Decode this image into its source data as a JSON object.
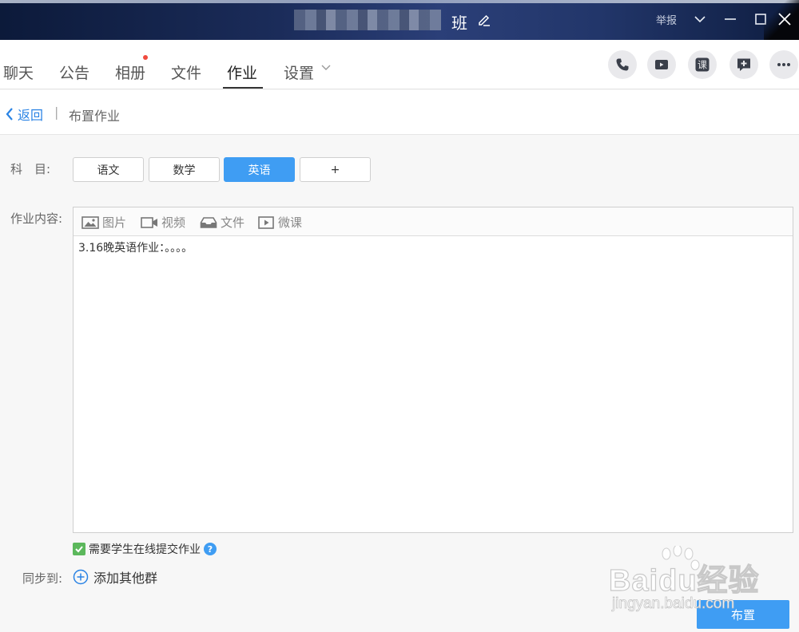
{
  "titlebar": {
    "class_name": "班",
    "report_label": "举报"
  },
  "tabs": [
    {
      "label": "聊天"
    },
    {
      "label": "公告"
    },
    {
      "label": "相册"
    },
    {
      "label": "文件"
    },
    {
      "label": "作业"
    },
    {
      "label": "设置"
    }
  ],
  "active_tab": "作业",
  "actions": {
    "course_label": "课"
  },
  "breadcrumb": {
    "back_label": "返回",
    "separator": "|",
    "current": "布置作业"
  },
  "form": {
    "subject_label": "科　目:",
    "subjects": [
      {
        "label": "语文"
      },
      {
        "label": "数学"
      },
      {
        "label": "英语"
      },
      {
        "label": "+"
      }
    ],
    "selected_subject": "英语",
    "content_label": "作业内容:",
    "toolbar": {
      "image_label": "图片",
      "video_label": "视频",
      "file_label": "文件",
      "microlesson_label": "微课"
    },
    "content_text": "3.16晚英语作业：。。。。",
    "require_online_label": "需要学生在线提交作业",
    "require_online_checked": true,
    "sync_label": "同步到:",
    "add_group_label": "添加其他群",
    "submit_label": "布置"
  },
  "watermark": {
    "main": "Baidu经验",
    "sub": "jingyan.baidu.com"
  },
  "colors": {
    "accent": "#3f9df3",
    "link": "#2a83e4",
    "check": "#5cb85c",
    "badge": "#f04a3e"
  }
}
